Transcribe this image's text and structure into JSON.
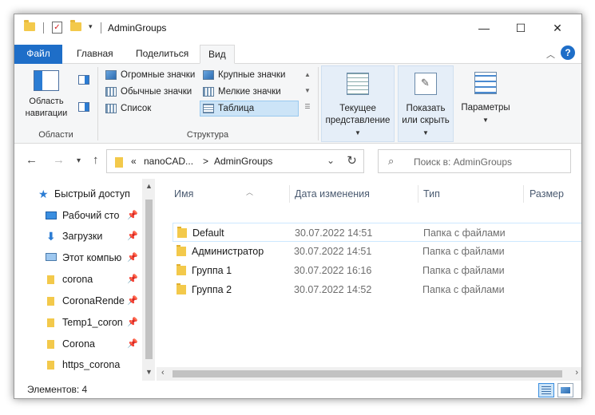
{
  "window": {
    "title": "AdminGroups",
    "minimize_icon": "—",
    "maximize_icon": "☐",
    "close_icon": "✕"
  },
  "ribbon_tabs": [
    {
      "label": "Файл"
    },
    {
      "label": "Главная"
    },
    {
      "label": "Поделиться"
    },
    {
      "label": "Вид"
    }
  ],
  "ribbon": {
    "areas_group": {
      "nav_pane_label_1": "Область",
      "nav_pane_label_2": "навигации",
      "group_label": "Области"
    },
    "layout_group": {
      "items": [
        {
          "label": "Огромные значки"
        },
        {
          "label": "Крупные значки"
        },
        {
          "label": "Обычные значки"
        },
        {
          "label": "Мелкие значки"
        },
        {
          "label": "Список"
        },
        {
          "label": "Таблица"
        }
      ],
      "selected": "Таблица",
      "group_label": "Структура"
    },
    "current_view": {
      "label_1": "Текущее",
      "label_2": "представление"
    },
    "show_hide": {
      "label_1": "Показать",
      "label_2": "или скрыть"
    },
    "options": {
      "label": "Параметры"
    }
  },
  "address": {
    "prefix": "«",
    "crumb_1": "nanoCAD...",
    "separator": ">",
    "crumb_2": "AdminGroups",
    "search_placeholder": "Поиск в: AdminGroups"
  },
  "nav_pane": {
    "items": [
      {
        "label": "Быстрый доступ",
        "icon": "star-icon"
      },
      {
        "label": "Рабочий сто",
        "icon": "desktop-icon"
      },
      {
        "label": "Загрузки",
        "icon": "download-icon"
      },
      {
        "label": "Этот компью",
        "icon": "computer-icon"
      },
      {
        "label": "corona",
        "icon": "folder-icon"
      },
      {
        "label": "CoronaRende",
        "icon": "folder-icon"
      },
      {
        "label": "Temp1_coron",
        "icon": "folder-icon"
      },
      {
        "label": "Corona",
        "icon": "folder-icon"
      },
      {
        "label": "https_corona",
        "icon": "folder-icon"
      }
    ]
  },
  "columns": {
    "name": "Имя",
    "date": "Дата изменения",
    "type": "Тип",
    "size": "Размер"
  },
  "files": [
    {
      "name": "Default",
      "date": "30.07.2022 14:51",
      "type": "Папка с файлами"
    },
    {
      "name": "Администратор",
      "date": "30.07.2022 14:51",
      "type": "Папка с файлами"
    },
    {
      "name": "Группа 1",
      "date": "30.07.2022 16:16",
      "type": "Папка с файлами"
    },
    {
      "name": "Группа 2",
      "date": "30.07.2022 14:52",
      "type": "Папка с файлами"
    }
  ],
  "status": {
    "count": "Элементов: 4"
  },
  "colors": {
    "accent": "#1e6ec8",
    "folder": "#f3c94b",
    "selection": "#cce4f7"
  }
}
